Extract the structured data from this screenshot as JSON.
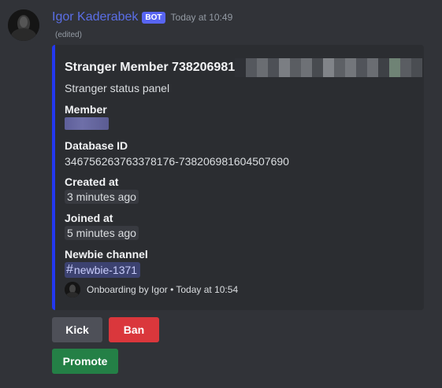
{
  "message": {
    "username": "Igor Kaderabek",
    "bot_tag": "BOT",
    "timestamp": "Today at 10:49",
    "edited": "(edited)"
  },
  "embed": {
    "accent_color": "#2338f0",
    "title": "Stranger Member 738206981",
    "description": "Stranger status panel",
    "fields": {
      "member": {
        "name": "Member"
      },
      "database_id": {
        "name": "Database ID",
        "value": "346756263763378176-738206981604507690"
      },
      "created_at": {
        "name": "Created at",
        "value": "3 minutes ago"
      },
      "joined_at": {
        "name": "Joined at",
        "value": "5 minutes ago"
      },
      "newbie_channel": {
        "name": "Newbie channel",
        "value": "newbie-1371",
        "hash": "#"
      }
    },
    "footer": "Onboarding by Igor • Today at 10:54"
  },
  "buttons": {
    "kick": "Kick",
    "ban": "Ban",
    "promote": "Promote"
  },
  "colors": {
    "background": "#313338",
    "embed_background": "#2b2d31",
    "username": "#5a6ee6",
    "kick": "#4e5058",
    "ban": "#da373c",
    "promote": "#248046"
  }
}
